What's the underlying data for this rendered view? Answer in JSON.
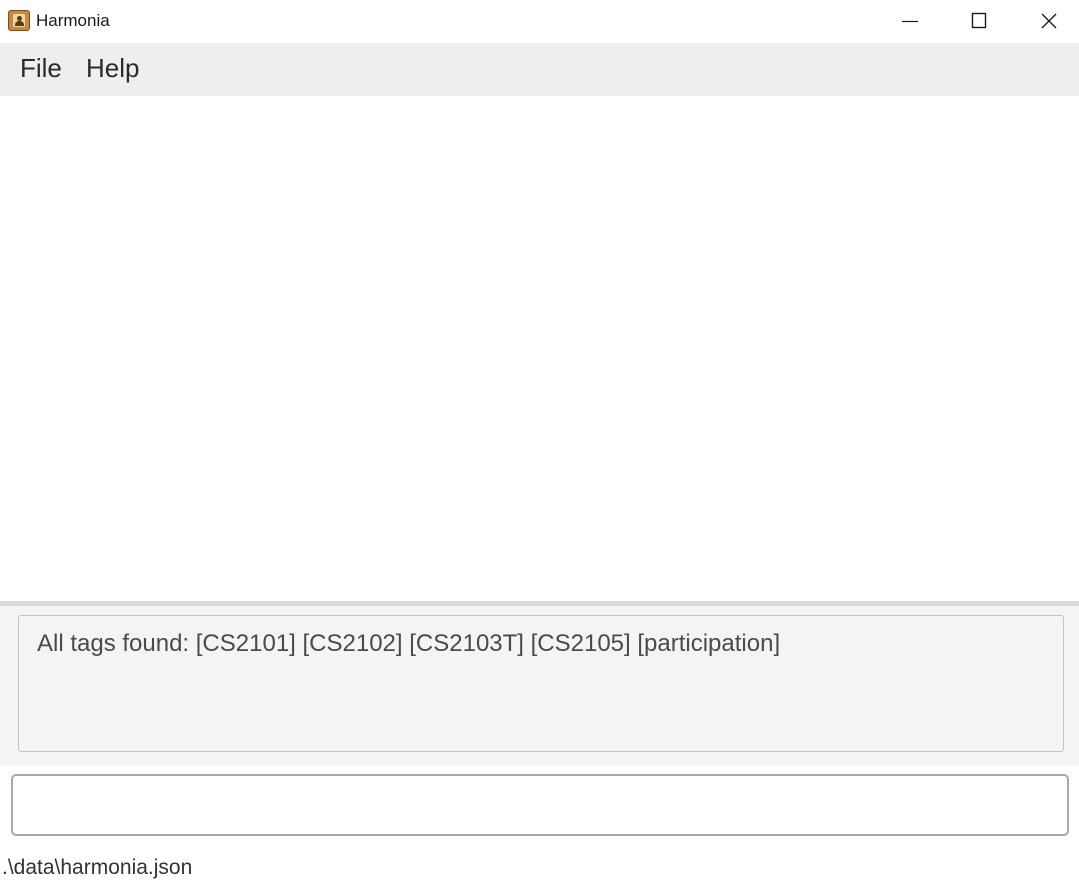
{
  "window": {
    "title": "Harmonia",
    "icon": "address-book-icon",
    "controls": [
      "minimize-icon",
      "maximize-icon",
      "close-icon"
    ]
  },
  "menubar": {
    "items": [
      {
        "label": "File"
      },
      {
        "label": "Help"
      }
    ]
  },
  "result": {
    "text": "All tags found: [CS2101] [CS2102] [CS2103T] [CS2105] [participation]"
  },
  "command": {
    "value": "",
    "placeholder": ""
  },
  "status": {
    "file_path": ".\\data\\harmonia.json"
  }
}
